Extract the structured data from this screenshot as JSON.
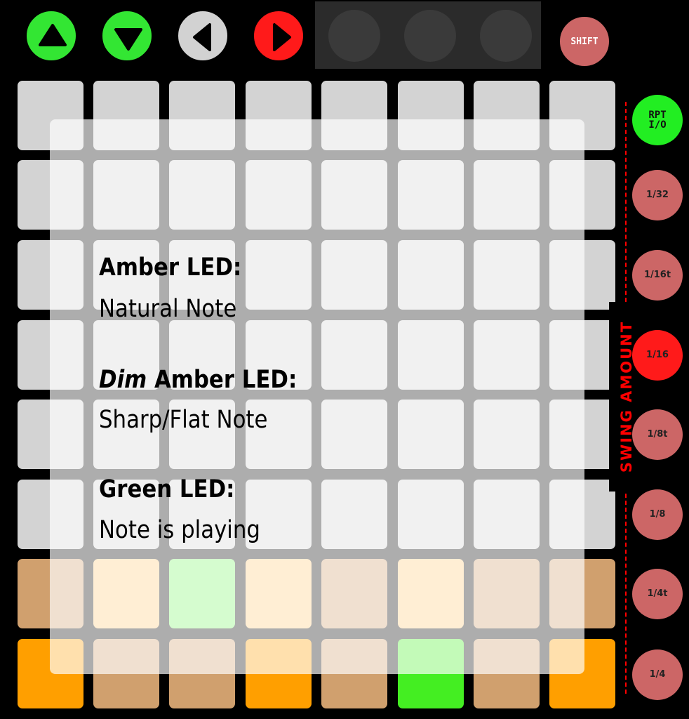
{
  "top_buttons": [
    {
      "name": "up-arrow-button",
      "icon": "triangle-up-icon",
      "color": "#33e633",
      "glyph_color": "#000000"
    },
    {
      "name": "down-arrow-button",
      "icon": "triangle-down-icon",
      "color": "#33e633",
      "glyph_color": "#000000"
    },
    {
      "name": "left-arrow-button",
      "icon": "triangle-left-icon",
      "color": "#d2d2d2",
      "glyph_color": "#000000"
    },
    {
      "name": "right-arrow-button",
      "icon": "triangle-right-icon",
      "color": "#ff1a1a",
      "glyph_color": "#000000"
    }
  ],
  "unlit_buttons_color": "#3a3a3a",
  "shift": {
    "label": "SHIFT",
    "color": "#cc6666"
  },
  "grid": {
    "rows": [
      [
        "#d3d3d3",
        "#d3d3d3",
        "#d3d3d3",
        "#d3d3d3",
        "#d3d3d3",
        "#d3d3d3",
        "#d3d3d3",
        "#d3d3d3"
      ],
      [
        "#d3d3d3",
        "#d3d3d3",
        "#d3d3d3",
        "#d3d3d3",
        "#d3d3d3",
        "#d3d3d3",
        "#d3d3d3",
        "#d3d3d3"
      ],
      [
        "#d3d3d3",
        "#d3d3d3",
        "#d3d3d3",
        "#d3d3d3",
        "#d3d3d3",
        "#d3d3d3",
        "#d3d3d3",
        "#d3d3d3"
      ],
      [
        "#d3d3d3",
        "#d3d3d3",
        "#d3d3d3",
        "#d3d3d3",
        "#d3d3d3",
        "#d3d3d3",
        "#d3d3d3",
        "#d3d3d3"
      ],
      [
        "#d3d3d3",
        "#d3d3d3",
        "#d3d3d3",
        "#d3d3d3",
        "#d3d3d3",
        "#d3d3d3",
        "#d3d3d3",
        "#d3d3d3"
      ],
      [
        "#d3d3d3",
        "#d3d3d3",
        "#d3d3d3",
        "#d3d3d3",
        "#d3d3d3",
        "#d3d3d3",
        "#d3d3d3",
        "#d3d3d3"
      ],
      [
        "#d0a06e",
        "#ffc97a",
        "#7cf56a",
        "#ffc97a",
        "#d0a06e",
        "#ffc97a",
        "#d0a06e",
        "#d0a06e"
      ],
      [
        "#ff9f00",
        "#d0a06e",
        "#d0a06e",
        "#ff9f00",
        "#d0a06e",
        "#44ee22",
        "#d0a06e",
        "#ff9f00"
      ]
    ]
  },
  "side_buttons": [
    {
      "label": "RPT\nI/O",
      "color": "#22ee22",
      "name": "repeat-toggle-button"
    },
    {
      "label": "1/32",
      "color": "#cc6666",
      "name": "swing-1-32-button"
    },
    {
      "label": "1/16t",
      "color": "#cc6666",
      "name": "swing-1-16t-button"
    },
    {
      "label": "1/16",
      "color": "#ff1a1a",
      "name": "swing-1-16-button"
    },
    {
      "label": "1/8t",
      "color": "#cc6666",
      "name": "swing-1-8t-button"
    },
    {
      "label": "1/8",
      "color": "#cc6666",
      "name": "swing-1-8-button"
    },
    {
      "label": "1/4t",
      "color": "#cc6666",
      "name": "swing-1-4t-button"
    },
    {
      "label": "1/4",
      "color": "#cc6666",
      "name": "swing-1-4-button"
    }
  ],
  "swing_label": "SWING AMOUNT",
  "legend": {
    "amber_title": "Amber LED:",
    "amber_desc": "Natural Note",
    "dim_word": "Dim",
    "dim_rest": " Amber LED:",
    "dim_desc": "Sharp/Flat Note",
    "green_title": "Green LED:",
    "green_desc": "Note is playing"
  }
}
